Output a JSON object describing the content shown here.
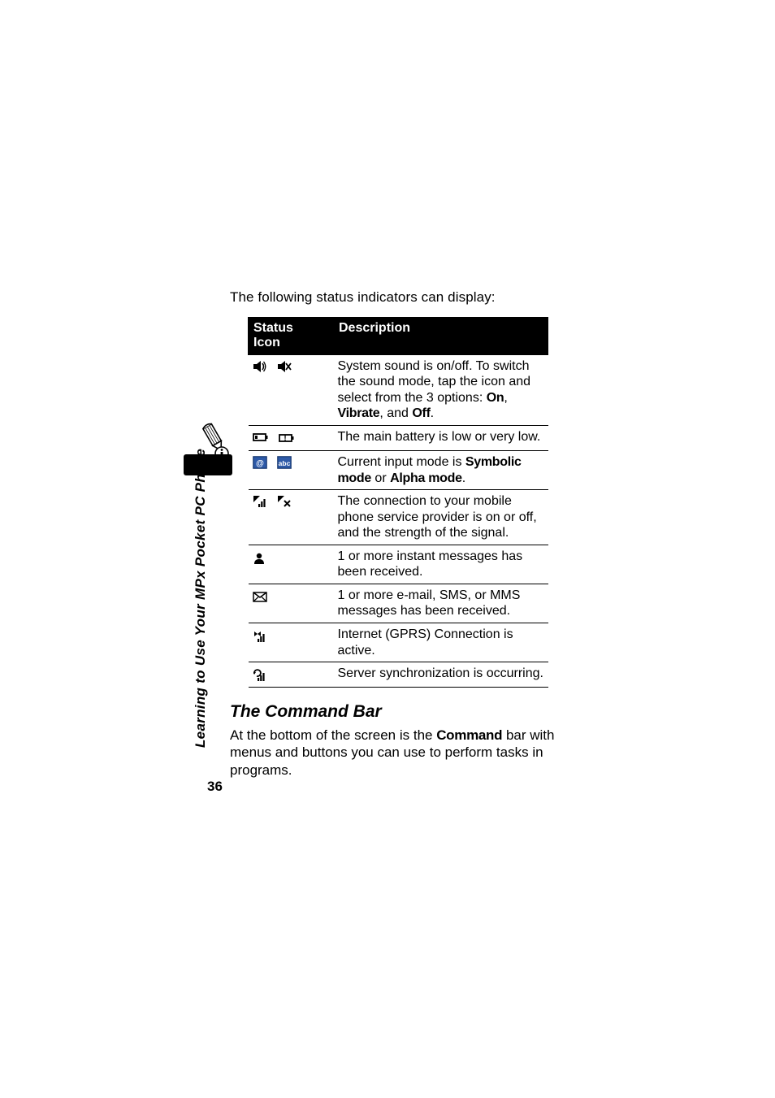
{
  "side_label": "Learning to Use Your MPx Pocket PC Phone",
  "page_number": "36",
  "intro": "The following status indicators can display:",
  "table": {
    "head_icon": "Status Icon",
    "head_desc": "Description",
    "rows": [
      {
        "icons": [
          "sound-on-icon",
          "sound-off-icon"
        ],
        "desc_pre": "System sound is on/off. To switch the sound mode, tap the icon and select from the 3 options: ",
        "opt1": "On",
        "comma1": ", ",
        "opt2": "Vibrate",
        "comma2": ", and ",
        "opt3": "Off",
        "period": "."
      },
      {
        "icons": [
          "battery-low-icon",
          "battery-very-low-icon"
        ],
        "desc": "The main battery is low or very low."
      },
      {
        "icons": [
          "input-symbolic-icon",
          "input-alpha-icon"
        ],
        "desc_pre": "Current input mode is ",
        "opt1": "Symbolic mode",
        "mid": " or ",
        "opt2": "Alpha mode",
        "period": "."
      },
      {
        "icons": [
          "signal-on-icon",
          "signal-off-icon"
        ],
        "desc": "The connection to your mobile phone service provider is on or off, and the strength of the signal."
      },
      {
        "icons": [
          "im-icon"
        ],
        "desc": "1 or more instant messages has been received."
      },
      {
        "icons": [
          "mail-icon"
        ],
        "desc": "1 or more e-mail, SMS, or MMS messages has been received."
      },
      {
        "icons": [
          "gprs-icon"
        ],
        "desc": "Internet (GPRS) Connection is active."
      },
      {
        "icons": [
          "sync-icon"
        ],
        "desc": "Server synchronization is occurring."
      }
    ]
  },
  "section_heading": "The Command Bar",
  "section_body_pre": "At the bottom of the screen is the ",
  "section_body_bold": "Command",
  "section_body_post": " bar with menus and buttons you can use to perform tasks in programs."
}
